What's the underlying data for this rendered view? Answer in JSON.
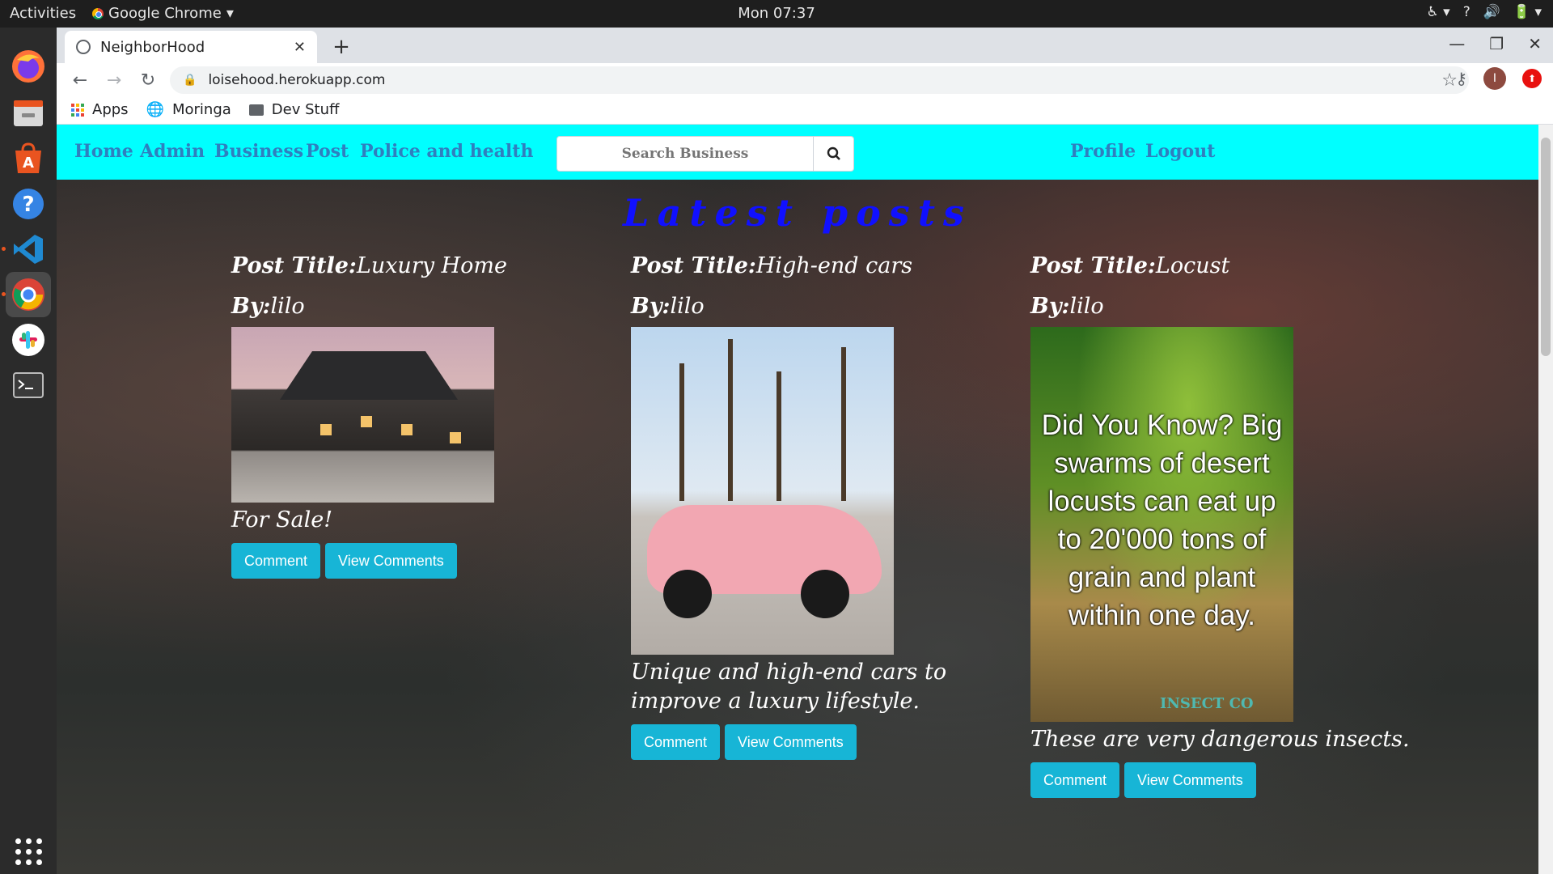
{
  "system": {
    "activities": "Activities",
    "app_name": "Google Chrome",
    "clock": "Mon 07:37",
    "tray": [
      "♿ ▾",
      "?",
      "🔊",
      "🔋 ▾"
    ]
  },
  "dock": {
    "items": [
      "firefox-icon",
      "files-icon",
      "software-icon",
      "help-icon",
      "vscode-icon",
      "chrome-icon",
      "slack-icon",
      "terminal-icon",
      "show-apps-icon"
    ]
  },
  "browser": {
    "tab_title": "NeighborHood",
    "url": "loisehood.herokuapp.com",
    "avatar_initial": "I",
    "bookmarks": [
      "Apps",
      "Moringa",
      "Dev Stuff"
    ]
  },
  "site": {
    "nav": {
      "left": [
        "Home",
        "Admin",
        "Business",
        "Post",
        "Police and health"
      ],
      "right": [
        "Profile",
        "Logout"
      ],
      "search_placeholder": "Search Business"
    },
    "heading": "Latest posts",
    "title_label": "Post Title:",
    "by_label": "By:",
    "posts": [
      {
        "title": "Luxury Home",
        "author": "lilo",
        "description": "For Sale!",
        "comment_label": "Comment",
        "view_label": "View Comments"
      },
      {
        "title": "High-end cars",
        "author": "lilo",
        "description": "Unique and high-end cars to improve a luxury lifestyle.",
        "comment_label": "Comment",
        "view_label": "View Comments"
      },
      {
        "title": "Locust",
        "author": "lilo",
        "description": "These are very dangerous insects.",
        "image_text": "Did You Know? Big swarms of desert locusts can eat up to 20'000 tons of grain and plant within one day.",
        "image_watermark": "INSECT CO",
        "comment_label": "Comment",
        "view_label": "View Comments"
      }
    ]
  },
  "colors": {
    "nav_bg": "#00ffff",
    "nav_link": "#2f7fbf",
    "heading": "#1010ff",
    "button": "#17b5d6"
  }
}
